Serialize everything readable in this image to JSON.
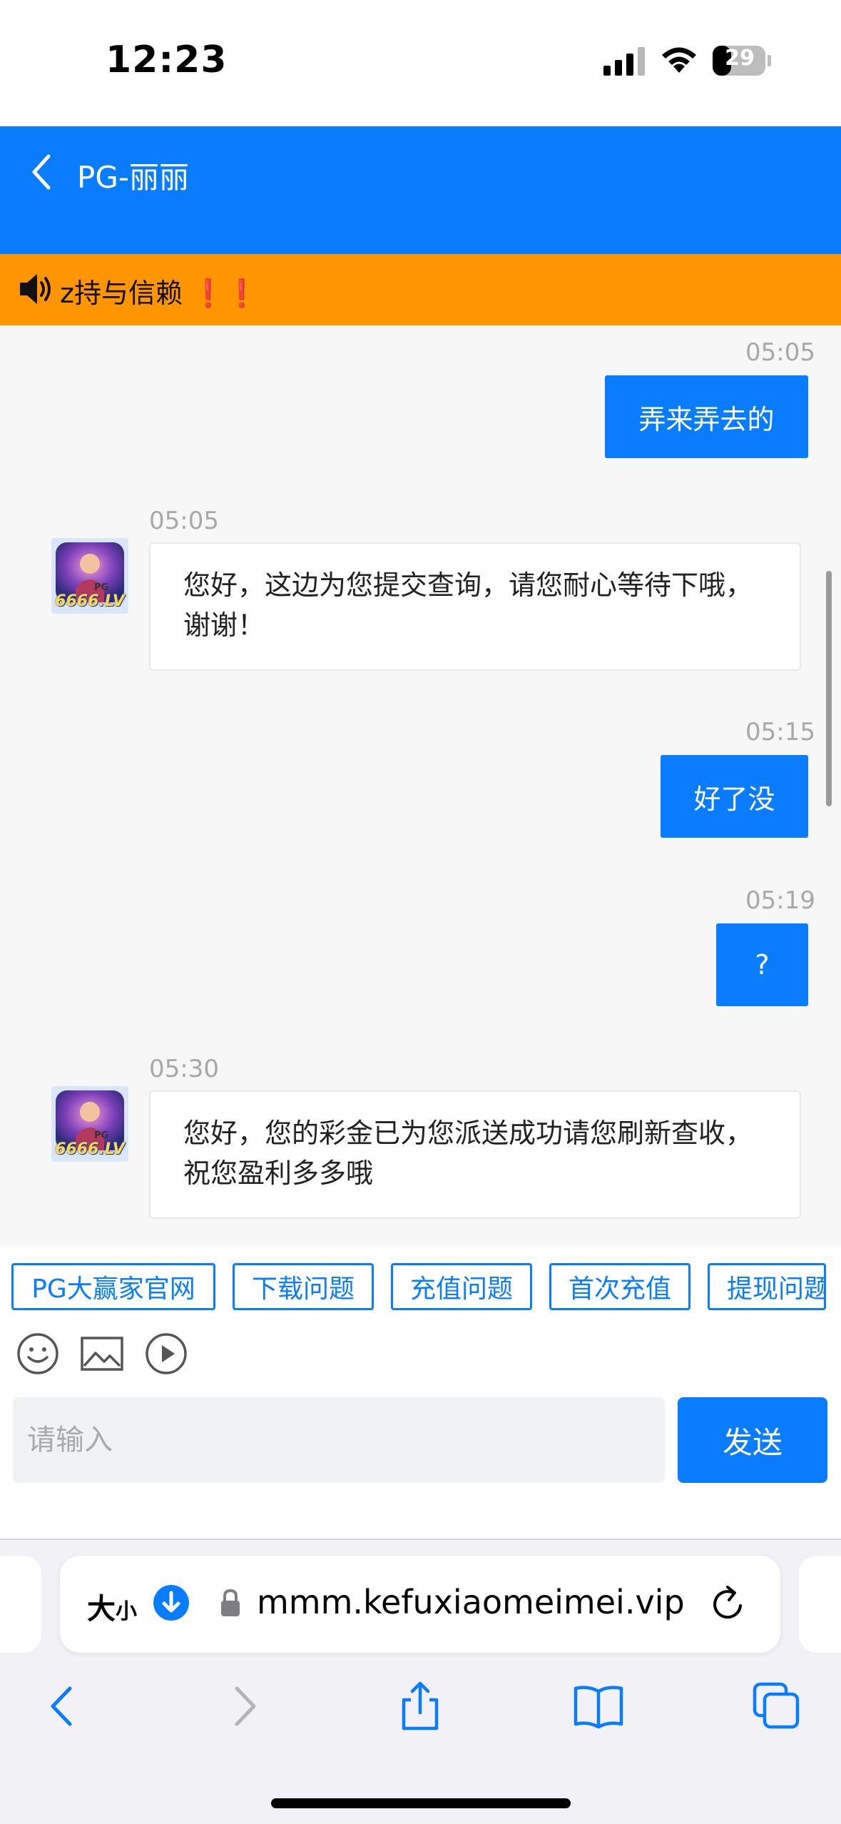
{
  "status_bar": {
    "time": "12:23",
    "battery": "29"
  },
  "header": {
    "title": "PG-丽丽"
  },
  "notice": {
    "text": "z持与信赖",
    "marks": "❗❗"
  },
  "messages": [
    {
      "time": "05:05",
      "text": "弄来弄去的",
      "side": "out"
    },
    {
      "time": "05:05",
      "line1": "您好，这边为您提交查询，请您耐心等待下哦，",
      "line2": "谢谢！",
      "side": "in",
      "avatar_label": "6666.LV",
      "avatar_tag": "PG"
    },
    {
      "time": "05:15",
      "text": "好了没",
      "side": "out"
    },
    {
      "time": "05:19",
      "text": "?",
      "side": "out"
    },
    {
      "time": "05:30",
      "line1": "您好，您的彩金已为您派送成功请您刷新查收，",
      "line2": "祝您盈利多多哦",
      "side": "in",
      "avatar_label": "6666.LV",
      "avatar_tag": "PG"
    }
  ],
  "quick_replies": [
    "PG大赢家官网",
    "下载问题",
    "充值问题",
    "首次充值",
    "提现问题"
  ],
  "input": {
    "placeholder": "请输入",
    "value": ""
  },
  "send_label": "发送",
  "browser": {
    "text_size_big": "大",
    "text_size_small": "小",
    "url": "mmm.kefuxiaomeimei.vip"
  },
  "colors": {
    "primary": "#0a7cff",
    "notice_bg": "#ff9500",
    "alert_red": "#e60012"
  }
}
